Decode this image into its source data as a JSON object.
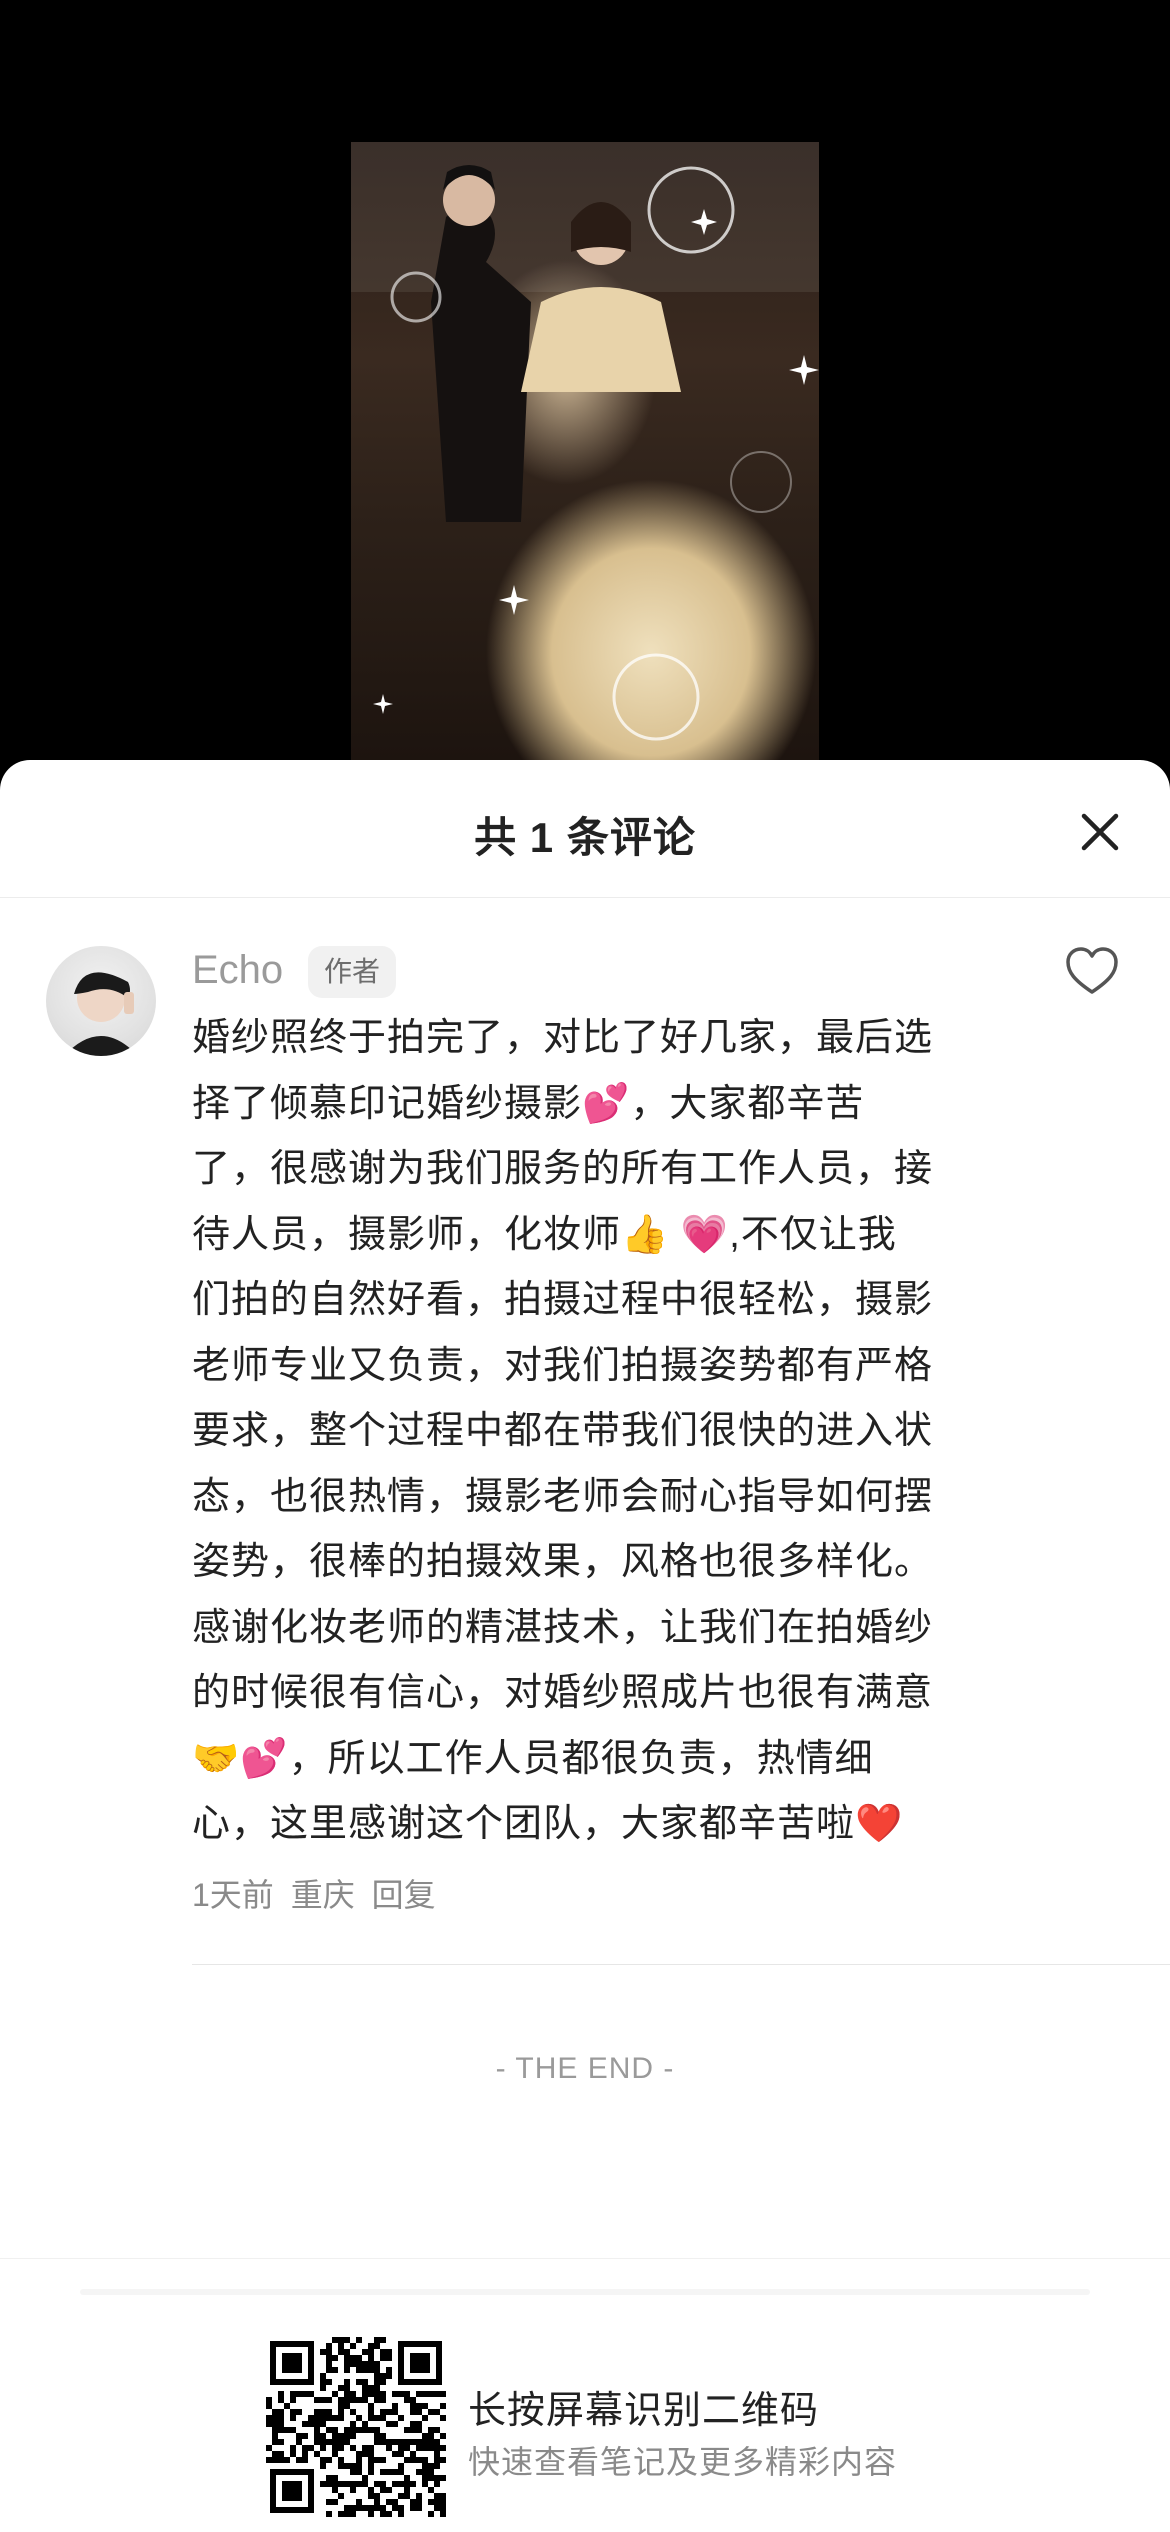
{
  "sheet": {
    "title": "共 1 条评论"
  },
  "comment": {
    "author": "Echo",
    "badge": "作者",
    "text": "婚纱照终于拍完了，对比了好几家，最后选\n择了倾慕印记婚纱摄影💕，大家都辛苦\n了，很感谢为我们服务的所有工作人员，接\n待人员，摄影师，化妆师👍 💗,不仅让我\n们拍的自然好看，拍摄过程中很轻松，摄影\n老师专业又负责，对我们拍摄姿势都有严格\n要求，整个过程中都在带我们很快的进入状\n态，也很热情，摄影老师会耐心指导如何摆\n姿势，很棒的拍摄效果，风格也很多样化。\n感谢化妆老师的精湛技术，让我们在拍婚纱\n的时候很有信心，对婚纱照成片也很有满意\n🤝💕，所以工作人员都很负责，热情细\n心，这里感谢这个团队，大家都辛苦啦❤️",
    "time": "1天前",
    "location": "重庆",
    "reply_label": "回复"
  },
  "end_text": "- THE END -",
  "footer": {
    "title": "长按屏幕识别二维码",
    "subtitle": "快速查看笔记及更多精彩内容"
  },
  "colors": {
    "accent_heart": "#e0433f",
    "text_primary": "#222222",
    "text_secondary": "#8a8a8a"
  }
}
